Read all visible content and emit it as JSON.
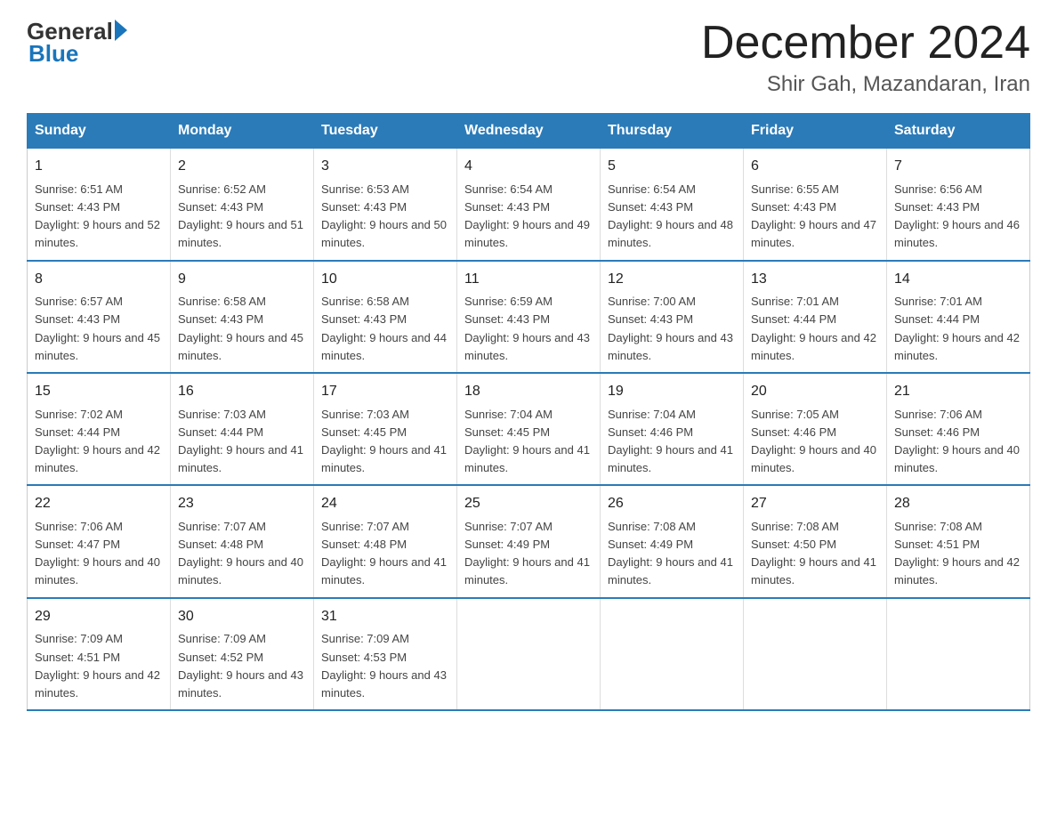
{
  "header": {
    "logo_general": "General",
    "logo_blue": "Blue",
    "month_title": "December 2024",
    "location": "Shir Gah, Mazandaran, Iran"
  },
  "days_of_week": [
    "Sunday",
    "Monday",
    "Tuesday",
    "Wednesday",
    "Thursday",
    "Friday",
    "Saturday"
  ],
  "weeks": [
    [
      {
        "day": "1",
        "sunrise": "6:51 AM",
        "sunset": "4:43 PM",
        "daylight": "9 hours and 52 minutes."
      },
      {
        "day": "2",
        "sunrise": "6:52 AM",
        "sunset": "4:43 PM",
        "daylight": "9 hours and 51 minutes."
      },
      {
        "day": "3",
        "sunrise": "6:53 AM",
        "sunset": "4:43 PM",
        "daylight": "9 hours and 50 minutes."
      },
      {
        "day": "4",
        "sunrise": "6:54 AM",
        "sunset": "4:43 PM",
        "daylight": "9 hours and 49 minutes."
      },
      {
        "day": "5",
        "sunrise": "6:54 AM",
        "sunset": "4:43 PM",
        "daylight": "9 hours and 48 minutes."
      },
      {
        "day": "6",
        "sunrise": "6:55 AM",
        "sunset": "4:43 PM",
        "daylight": "9 hours and 47 minutes."
      },
      {
        "day": "7",
        "sunrise": "6:56 AM",
        "sunset": "4:43 PM",
        "daylight": "9 hours and 46 minutes."
      }
    ],
    [
      {
        "day": "8",
        "sunrise": "6:57 AM",
        "sunset": "4:43 PM",
        "daylight": "9 hours and 45 minutes."
      },
      {
        "day": "9",
        "sunrise": "6:58 AM",
        "sunset": "4:43 PM",
        "daylight": "9 hours and 45 minutes."
      },
      {
        "day": "10",
        "sunrise": "6:58 AM",
        "sunset": "4:43 PM",
        "daylight": "9 hours and 44 minutes."
      },
      {
        "day": "11",
        "sunrise": "6:59 AM",
        "sunset": "4:43 PM",
        "daylight": "9 hours and 43 minutes."
      },
      {
        "day": "12",
        "sunrise": "7:00 AM",
        "sunset": "4:43 PM",
        "daylight": "9 hours and 43 minutes."
      },
      {
        "day": "13",
        "sunrise": "7:01 AM",
        "sunset": "4:44 PM",
        "daylight": "9 hours and 42 minutes."
      },
      {
        "day": "14",
        "sunrise": "7:01 AM",
        "sunset": "4:44 PM",
        "daylight": "9 hours and 42 minutes."
      }
    ],
    [
      {
        "day": "15",
        "sunrise": "7:02 AM",
        "sunset": "4:44 PM",
        "daylight": "9 hours and 42 minutes."
      },
      {
        "day": "16",
        "sunrise": "7:03 AM",
        "sunset": "4:44 PM",
        "daylight": "9 hours and 41 minutes."
      },
      {
        "day": "17",
        "sunrise": "7:03 AM",
        "sunset": "4:45 PM",
        "daylight": "9 hours and 41 minutes."
      },
      {
        "day": "18",
        "sunrise": "7:04 AM",
        "sunset": "4:45 PM",
        "daylight": "9 hours and 41 minutes."
      },
      {
        "day": "19",
        "sunrise": "7:04 AM",
        "sunset": "4:46 PM",
        "daylight": "9 hours and 41 minutes."
      },
      {
        "day": "20",
        "sunrise": "7:05 AM",
        "sunset": "4:46 PM",
        "daylight": "9 hours and 40 minutes."
      },
      {
        "day": "21",
        "sunrise": "7:06 AM",
        "sunset": "4:46 PM",
        "daylight": "9 hours and 40 minutes."
      }
    ],
    [
      {
        "day": "22",
        "sunrise": "7:06 AM",
        "sunset": "4:47 PM",
        "daylight": "9 hours and 40 minutes."
      },
      {
        "day": "23",
        "sunrise": "7:07 AM",
        "sunset": "4:48 PM",
        "daylight": "9 hours and 40 minutes."
      },
      {
        "day": "24",
        "sunrise": "7:07 AM",
        "sunset": "4:48 PM",
        "daylight": "9 hours and 41 minutes."
      },
      {
        "day": "25",
        "sunrise": "7:07 AM",
        "sunset": "4:49 PM",
        "daylight": "9 hours and 41 minutes."
      },
      {
        "day": "26",
        "sunrise": "7:08 AM",
        "sunset": "4:49 PM",
        "daylight": "9 hours and 41 minutes."
      },
      {
        "day": "27",
        "sunrise": "7:08 AM",
        "sunset": "4:50 PM",
        "daylight": "9 hours and 41 minutes."
      },
      {
        "day": "28",
        "sunrise": "7:08 AM",
        "sunset": "4:51 PM",
        "daylight": "9 hours and 42 minutes."
      }
    ],
    [
      {
        "day": "29",
        "sunrise": "7:09 AM",
        "sunset": "4:51 PM",
        "daylight": "9 hours and 42 minutes."
      },
      {
        "day": "30",
        "sunrise": "7:09 AM",
        "sunset": "4:52 PM",
        "daylight": "9 hours and 43 minutes."
      },
      {
        "day": "31",
        "sunrise": "7:09 AM",
        "sunset": "4:53 PM",
        "daylight": "9 hours and 43 minutes."
      },
      null,
      null,
      null,
      null
    ]
  ]
}
